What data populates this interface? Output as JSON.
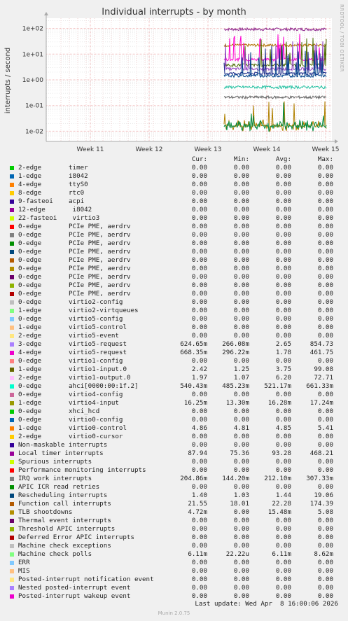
{
  "chart_data": {
    "type": "line",
    "title": "Individual interrupts - by month",
    "ylabel": "interrupts / second",
    "yscale": "log",
    "ylim": [
      0.004,
      250
    ],
    "y_ticks": [
      "1e-02",
      "1e-01",
      "1e+00",
      "1e+01",
      "1e+02"
    ],
    "x_ticks": [
      "Week 11",
      "Week 12",
      "Week 13",
      "Week 14",
      "Week 15"
    ],
    "series_approx": [
      {
        "name": "Local timer interrupts",
        "color": "#8a1f8a",
        "level": 93.28
      },
      {
        "name": "Function call interrupts",
        "color": "#b07000",
        "level": 22.28
      },
      {
        "name": "virtio1-output.0",
        "color": "#ff00d0",
        "level": 6.2
      },
      {
        "name": "virtio1-input.0",
        "color": "#4a6a00",
        "level": 3.75
      },
      {
        "name": "virtio5-request",
        "color": "#9040c0",
        "level": 2.65
      },
      {
        "name": "virtio4-request",
        "color": "#1a2a8a",
        "level": 1.78
      },
      {
        "name": "Rescheduling interrupts",
        "color": "#00408a",
        "level": 1.44
      },
      {
        "name": "ahci[0000:00:1f.2]",
        "color": "#20c0a0",
        "level": 0.52
      },
      {
        "name": "IRQ work interrupts",
        "color": "#606060",
        "level": 0.21
      },
      {
        "name": "virtio4-input",
        "color": "#b08000",
        "level": 0.0163
      },
      {
        "name": "TLB shootdowns",
        "color": "#008a40",
        "level": 0.0155
      }
    ]
  },
  "side_label": "RRDTOOL / TOBI OETIKER",
  "legend_header": {
    "cur": "Cur:",
    "min": "Min:",
    "avg": "Avg:",
    "max": "Max:"
  },
  "legend": [
    {
      "name": "2-edge",
      "desc": "timer",
      "color": "#00cc00",
      "cur": "0.00",
      "min": "0.00",
      "avg": "0.00",
      "max": "0.00"
    },
    {
      "name": "1-edge",
      "desc": "i8042",
      "color": "#0066b3",
      "cur": "0.00",
      "min": "0.00",
      "avg": "0.00",
      "max": "0.00"
    },
    {
      "name": "4-edge",
      "desc": "ttyS0",
      "color": "#ff8000",
      "cur": "0.00",
      "min": "0.00",
      "avg": "0.00",
      "max": "0.00"
    },
    {
      "name": "8-edge",
      "desc": "rtc0",
      "color": "#ffcc00",
      "cur": "0.00",
      "min": "0.00",
      "avg": "0.00",
      "max": "0.00"
    },
    {
      "name": "9-fasteoi",
      "desc": "acpi",
      "color": "#330099",
      "cur": "0.00",
      "min": "0.00",
      "avg": "0.00",
      "max": "0.00"
    },
    {
      "name": "12-edge",
      "desc": " i8042",
      "color": "#990099",
      "cur": "0.00",
      "min": "0.00",
      "avg": "0.00",
      "max": "0.00"
    },
    {
      "name": "22-fasteoi",
      "desc": " virtio3",
      "color": "#ccff00",
      "cur": "0.00",
      "min": "0.00",
      "avg": "0.00",
      "max": "0.00"
    },
    {
      "name": "0-edge",
      "desc": "PCIe PME, aerdrv",
      "color": "#ff0000",
      "cur": "0.00",
      "min": "0.00",
      "avg": "0.00",
      "max": "0.00"
    },
    {
      "name": "0-edge",
      "desc": "PCIe PME, aerdrv",
      "color": "#808080",
      "cur": "0.00",
      "min": "0.00",
      "avg": "0.00",
      "max": "0.00"
    },
    {
      "name": "0-edge",
      "desc": "PCIe PME, aerdrv",
      "color": "#008f00",
      "cur": "0.00",
      "min": "0.00",
      "avg": "0.00",
      "max": "0.00"
    },
    {
      "name": "0-edge",
      "desc": "PCIe PME, aerdrv",
      "color": "#00487d",
      "cur": "0.00",
      "min": "0.00",
      "avg": "0.00",
      "max": "0.00"
    },
    {
      "name": "0-edge",
      "desc": "PCIe PME, aerdrv",
      "color": "#b35a00",
      "cur": "0.00",
      "min": "0.00",
      "avg": "0.00",
      "max": "0.00"
    },
    {
      "name": "0-edge",
      "desc": "PCIe PME, aerdrv",
      "color": "#b38f00",
      "cur": "0.00",
      "min": "0.00",
      "avg": "0.00",
      "max": "0.00"
    },
    {
      "name": "0-edge",
      "desc": "PCIe PME, aerdrv",
      "color": "#6b006b",
      "cur": "0.00",
      "min": "0.00",
      "avg": "0.00",
      "max": "0.00"
    },
    {
      "name": "0-edge",
      "desc": "PCIe PME, aerdrv",
      "color": "#8fb300",
      "cur": "0.00",
      "min": "0.00",
      "avg": "0.00",
      "max": "0.00"
    },
    {
      "name": "0-edge",
      "desc": "PCIe PME, aerdrv",
      "color": "#b30000",
      "cur": "0.00",
      "min": "0.00",
      "avg": "0.00",
      "max": "0.00"
    },
    {
      "name": "0-edge",
      "desc": "virtio2-config",
      "color": "#bebebe",
      "cur": "0.00",
      "min": "0.00",
      "avg": "0.00",
      "max": "0.00"
    },
    {
      "name": "1-edge",
      "desc": "virtio2-virtqueues",
      "color": "#80ff80",
      "cur": "0.00",
      "min": "0.00",
      "avg": "0.00",
      "max": "0.00"
    },
    {
      "name": "0-edge",
      "desc": "virtio5-config",
      "color": "#80c9ff",
      "cur": "0.00",
      "min": "0.00",
      "avg": "0.00",
      "max": "0.00"
    },
    {
      "name": "1-edge",
      "desc": "virtio5-control",
      "color": "#ffc080",
      "cur": "0.00",
      "min": "0.00",
      "avg": "0.00",
      "max": "0.00"
    },
    {
      "name": "2-edge",
      "desc": "virtio5-event",
      "color": "#ffe680",
      "cur": "0.00",
      "min": "0.00",
      "avg": "0.00",
      "max": "0.00"
    },
    {
      "name": "3-edge",
      "desc": "virtio5-request",
      "color": "#aa80ff",
      "cur": "624.65m",
      "min": "266.08m",
      "avg": "2.65",
      "max": "854.73"
    },
    {
      "name": "4-edge",
      "desc": "virtio5-request",
      "color": "#ee00cc",
      "cur": "668.35m",
      "min": "296.22m",
      "avg": "1.78",
      "max": "461.75"
    },
    {
      "name": "0-edge",
      "desc": "virtio1-config",
      "color": "#ff8080",
      "cur": "0.00",
      "min": "0.00",
      "avg": "0.00",
      "max": "0.00"
    },
    {
      "name": "1-edge",
      "desc": "virtio1-input.0",
      "color": "#666600",
      "cur": "2.42",
      "min": "1.25",
      "avg": "3.75",
      "max": "99.08"
    },
    {
      "name": "2-edge",
      "desc": "virtio1-output.0",
      "color": "#ffbfff",
      "cur": "1.97",
      "min": "1.07",
      "avg": "6.20",
      "max": "72.71"
    },
    {
      "name": "0-edge",
      "desc": "ahci[0000:00:1f.2]",
      "color": "#00ffcc",
      "cur": "540.43m",
      "min": "485.23m",
      "avg": "521.17m",
      "max": "661.33m"
    },
    {
      "name": "0-edge",
      "desc": "virtio4-config",
      "color": "#cc6699",
      "cur": "0.00",
      "min": "0.00",
      "avg": "0.00",
      "max": "0.00"
    },
    {
      "name": "1-edge",
      "desc": "virtio4-input",
      "color": "#999900",
      "cur": "16.25m",
      "min": "13.30m",
      "avg": "16.28m",
      "max": "17.24m"
    },
    {
      "name": "0-edge",
      "desc": "xhci_hcd",
      "color": "#00cc00",
      "cur": "0.00",
      "min": "0.00",
      "avg": "0.00",
      "max": "0.00"
    },
    {
      "name": "0-edge",
      "desc": "virtio0-config",
      "color": "#0066b3",
      "cur": "0.00",
      "min": "0.00",
      "avg": "0.00",
      "max": "0.00"
    },
    {
      "name": "1-edge",
      "desc": "virtio0-control",
      "color": "#ff8000",
      "cur": "4.86",
      "min": "4.81",
      "avg": "4.85",
      "max": "5.41"
    },
    {
      "name": "2-edge",
      "desc": "virtio0-cursor",
      "color": "#ffcc00",
      "cur": "0.00",
      "min": "0.00",
      "avg": "0.00",
      "max": "0.00"
    },
    {
      "name": "Non-maskable interrupts",
      "desc": "",
      "color": "#330099",
      "cur": "0.00",
      "min": "0.00",
      "avg": "0.00",
      "max": "0.00"
    },
    {
      "name": "Local timer interrupts",
      "desc": "",
      "color": "#990099",
      "cur": "87.94",
      "min": "75.36",
      "avg": "93.28",
      "max": "468.21"
    },
    {
      "name": "Spurious interrupts",
      "desc": "",
      "color": "#ccff00",
      "cur": "0.00",
      "min": "0.00",
      "avg": "0.00",
      "max": "0.00"
    },
    {
      "name": "Performance monitoring interrupts",
      "desc": "",
      "color": "#ff0000",
      "cur": "0.00",
      "min": "0.00",
      "avg": "0.00",
      "max": "0.00"
    },
    {
      "name": "IRQ work interrupts",
      "desc": "",
      "color": "#808080",
      "cur": "204.86m",
      "min": "144.20m",
      "avg": "212.10m",
      "max": "307.33m"
    },
    {
      "name": "APIC ICR read retries",
      "desc": "",
      "color": "#008f00",
      "cur": "0.00",
      "min": "0.00",
      "avg": "0.00",
      "max": "0.00"
    },
    {
      "name": "Rescheduling interrupts",
      "desc": "",
      "color": "#00487d",
      "cur": "1.40",
      "min": "1.03",
      "avg": "1.44",
      "max": "19.06"
    },
    {
      "name": "Function call interrupts",
      "desc": "",
      "color": "#b35a00",
      "cur": "21.55",
      "min": "18.01",
      "avg": "22.28",
      "max": "174.39"
    },
    {
      "name": "TLB shootdowns",
      "desc": "",
      "color": "#b38f00",
      "cur": "4.72m",
      "min": "0.00",
      "avg": "15.48m",
      "max": "5.08"
    },
    {
      "name": "Thermal event interrupts",
      "desc": "",
      "color": "#6b006b",
      "cur": "0.00",
      "min": "0.00",
      "avg": "0.00",
      "max": "0.00"
    },
    {
      "name": "Threshold APIC interrupts",
      "desc": "",
      "color": "#8fb300",
      "cur": "0.00",
      "min": "0.00",
      "avg": "0.00",
      "max": "0.00"
    },
    {
      "name": "Deferred Error APIC interrupts",
      "desc": "",
      "color": "#b30000",
      "cur": "0.00",
      "min": "0.00",
      "avg": "0.00",
      "max": "0.00"
    },
    {
      "name": "Machine check exceptions",
      "desc": "",
      "color": "#bebebe",
      "cur": "0.00",
      "min": "0.00",
      "avg": "0.00",
      "max": "0.00"
    },
    {
      "name": "Machine check polls",
      "desc": "",
      "color": "#80ff80",
      "cur": "6.11m",
      "min": "22.22u",
      "avg": "6.11m",
      "max": "8.62m"
    },
    {
      "name": "ERR",
      "desc": "",
      "color": "#80c9ff",
      "cur": "0.00",
      "min": "0.00",
      "avg": "0.00",
      "max": "0.00"
    },
    {
      "name": "MIS",
      "desc": "",
      "color": "#ffc080",
      "cur": "0.00",
      "min": "0.00",
      "avg": "0.00",
      "max": "0.00"
    },
    {
      "name": "Posted-interrupt notification event",
      "desc": "",
      "color": "#ffe680",
      "cur": "0.00",
      "min": "0.00",
      "avg": "0.00",
      "max": "0.00"
    },
    {
      "name": "Nested posted-interrupt event",
      "desc": "",
      "color": "#aa80ff",
      "cur": "0.00",
      "min": "0.00",
      "avg": "0.00",
      "max": "0.00"
    },
    {
      "name": "Posted-interrupt wakeup event",
      "desc": "",
      "color": "#ee00cc",
      "cur": "0.00",
      "min": "0.00",
      "avg": "0.00",
      "max": "0.00"
    }
  ],
  "last_update": "Last update: Wed Apr  8 16:00:06 2026",
  "footer": "Munin 2.0.75"
}
